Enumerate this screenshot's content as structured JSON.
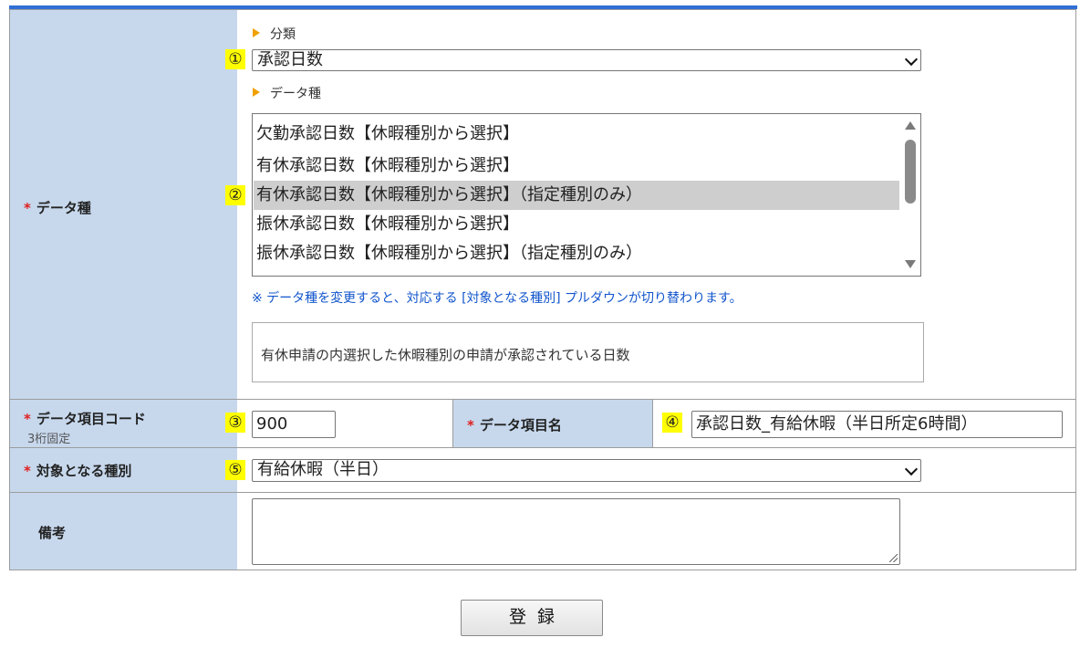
{
  "form": {
    "data_type": {
      "label": "データ種",
      "category_heading": "分類",
      "category_value": "承認日数",
      "type_heading": "データ種",
      "options": [
        "欠勤承認日数【休暇種別から選択】",
        "有休承認日数【休暇種別から選択】",
        "有休承認日数【休暇種別から選択】（指定種別のみ）",
        "振休承認日数【休暇種別から選択】",
        "振休承認日数【休暇種別から選択】（指定種別のみ）"
      ],
      "selected_index": 2,
      "note": "※ データ種を変更すると、対応する [対象となる種別] プルダウンが切り替わります。",
      "description": "有休申請の内選択した休暇種別の申請が承認されている日数"
    },
    "item_code": {
      "label": "データ項目コード",
      "sublabel": "3桁固定",
      "value": "900"
    },
    "item_name": {
      "label": "データ項目名",
      "value": "承認日数_有給休暇（半日所定6時間）"
    },
    "target_type": {
      "label": "対象となる種別",
      "value": "有給休暇（半日）"
    },
    "remarks": {
      "label": "備考",
      "value": ""
    },
    "required_mark": "*",
    "submit_label": "登録"
  },
  "badges": [
    "①",
    "②",
    "③",
    "④",
    "⑤"
  ],
  "colors": {
    "label_bg": "#c7d8ed",
    "highlight": "#ffff00",
    "required": "#e02020",
    "note_text": "#1155cc",
    "top_bar": "#2f6fd6",
    "selected_option": "#cecece"
  }
}
